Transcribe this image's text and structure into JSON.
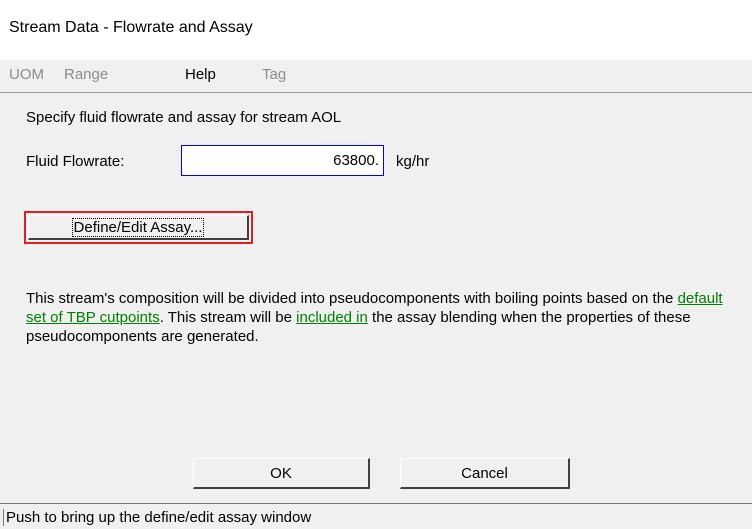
{
  "window": {
    "title": "Stream Data - Flowrate and Assay"
  },
  "menu": {
    "items": [
      {
        "label": "UOM",
        "enabled": false
      },
      {
        "label": "Range",
        "enabled": false
      },
      {
        "label": "Help",
        "enabled": true
      },
      {
        "label": "Tag",
        "enabled": false
      }
    ]
  },
  "form": {
    "instruction": "Specify fluid flowrate and assay for stream AOL",
    "flowrate_label": "Fluid Flowrate:",
    "flowrate_value": "63800.",
    "flowrate_unit": "kg/hr",
    "define_button_label": "Define/Edit Assay..."
  },
  "description": {
    "part1": "This stream's composition will be divided into pseudocomponents with boiling points based on the ",
    "link1": "default set of TBP cutpoints",
    "part2": ".  This stream will be ",
    "link2": "included in",
    "part3": " the assay blending when the properties of these pseudocomponents are generated."
  },
  "buttons": {
    "ok_label": "OK",
    "cancel_label": "Cancel"
  },
  "status": {
    "text": "Push to bring up the define/edit assay window"
  },
  "colors": {
    "link": "#008000",
    "focus_border": "#0000ff",
    "highlight_border": "#e02020",
    "disabled_text": "#8c8c8c"
  }
}
